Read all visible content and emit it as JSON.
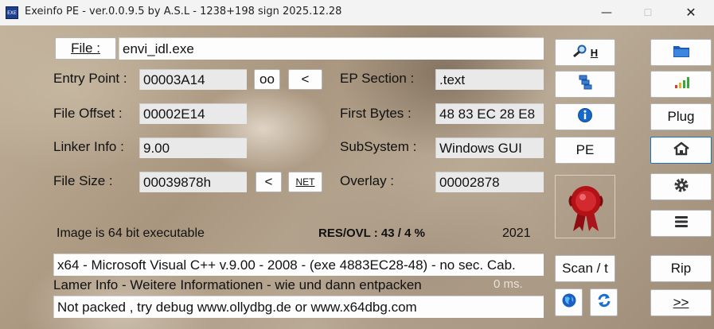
{
  "window": {
    "title": "Exeinfo PE - ver.0.0.9.5  by A.S.L -  1238+198 sign  2025.12.28",
    "controls": {
      "minimize": "—",
      "maximize": "☐",
      "close": "✕"
    }
  },
  "file": {
    "button_label": "File :",
    "path": "envi_idl.exe"
  },
  "entry_point": {
    "label": "Entry Point :",
    "value": "00003A14",
    "oo_label": "oo",
    "arrow_label": "<"
  },
  "ep_section": {
    "label": "EP Section :",
    "value": ".text"
  },
  "file_offset": {
    "label": "File Offset :",
    "value": "00002E14"
  },
  "first_bytes": {
    "label": "First Bytes :",
    "value": "48 83 EC 28 E8"
  },
  "linker_info": {
    "label": "Linker Info :",
    "value": "9.00"
  },
  "subsystem": {
    "label": "SubSystem :",
    "value": "Windows GUI"
  },
  "file_size": {
    "label": "File Size :",
    "value": "00039878h",
    "arrow_label": "<",
    "net_label": "NET"
  },
  "overlay": {
    "label": "Overlay :",
    "value": "00002878"
  },
  "status": {
    "image_bits": "Image is 64 bit executable",
    "res_ovl": "RES/OVL : 43 / 4 %",
    "year": "2021"
  },
  "detection": "x64 - Microsoft Visual C++ v.9.00 - 2008 - (exe 4883EC28-48) - no sec. Cab.",
  "lamer": {
    "text": "Lamer Info - Weitere Informationen - wie und dann entpacken",
    "time": "0 ms."
  },
  "hint": "Not packed , try debug www.ollydbg.de or www.x64dbg.com",
  "middle_buttons": {
    "h_label": "H",
    "pe_label": "PE",
    "scan_label": "Scan / t"
  },
  "right_buttons": {
    "plug_label": "Plug",
    "rip_label": "Rip",
    "next_label": ">>"
  },
  "colors": {
    "accent_blue": "#1a73c8",
    "seal_red": "#b31217"
  }
}
